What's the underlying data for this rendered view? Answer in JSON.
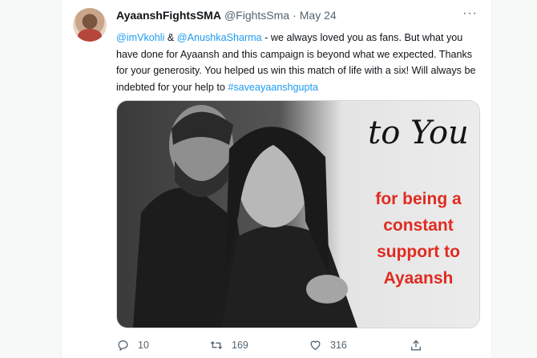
{
  "tweet": {
    "display_name": "AyaanshFightsSMA",
    "handle": "@FightsSma",
    "separator": "·",
    "date": "May 24",
    "more": "···",
    "mention1": "@imVkohli",
    "amp": " & ",
    "mention2": "@AnushkaSharma",
    "body": " - we always loved you as fans. But what you have done for Ayaansh and this campaign is beyond what we expected. Thanks for your generosity. You helped us win this match of life with a six! Will always be indebted for your help to ",
    "hashtag": "#saveayaanshgupta"
  },
  "image": {
    "title": "to You",
    "lines": [
      "for being a",
      "constant",
      "support to",
      "Ayaansh"
    ]
  },
  "actions": {
    "replies": "10",
    "retweets": "169",
    "likes": "316"
  },
  "icons": {
    "reply": "reply-icon",
    "retweet": "retweet-icon",
    "like": "heart-icon",
    "share": "share-icon",
    "more": "more-icon"
  }
}
